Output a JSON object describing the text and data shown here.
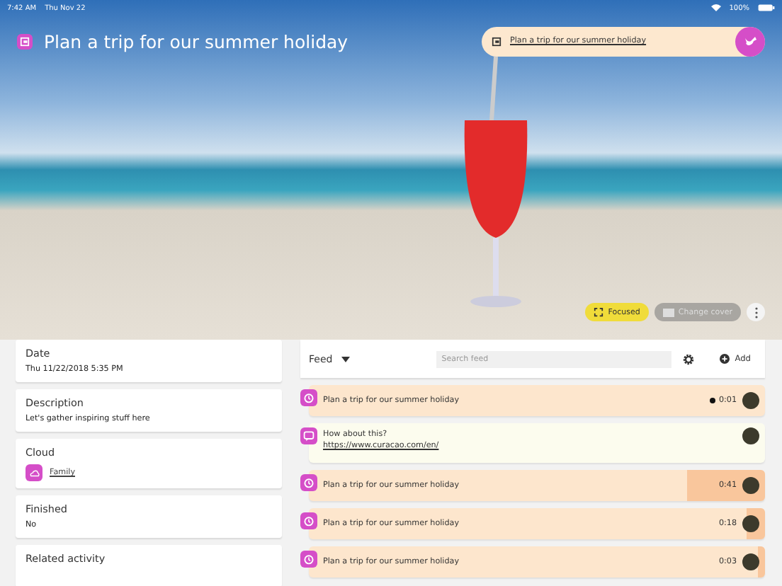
{
  "status_bar": {
    "time": "7:42 AM",
    "date": "Thu Nov 22",
    "battery": "100%"
  },
  "header": {
    "title": "Plan a trip for our summer holiday",
    "pinned_link": "Plan a trip for our summer holiday"
  },
  "cover_actions": {
    "focused": {
      "label": "Focused",
      "on": true
    },
    "change_cover": {
      "label": "Change cover",
      "disabled": true
    }
  },
  "details": [
    {
      "kind": "text",
      "label": "Date",
      "value": "Thu 11/22/2018 5:35 PM"
    },
    {
      "kind": "text",
      "label": "Description",
      "value": "Let's gather inspiring stuff here"
    },
    {
      "kind": "link",
      "label": "Cloud",
      "value": "Family"
    },
    {
      "kind": "text",
      "label": "Finished",
      "value": "No"
    },
    {
      "kind": "heading",
      "label": "Related activity"
    }
  ],
  "feed": {
    "filter": "Feed",
    "search_placeholder": "Search feed",
    "add_label": "Add",
    "items": [
      {
        "kind": "timer",
        "text": "Plan a trip for our summer holiday",
        "duration": "0:01",
        "recording": true,
        "level": 0
      },
      {
        "kind": "note",
        "text": "How about this?",
        "link": "https://www.curacao.com/en/"
      },
      {
        "kind": "timer",
        "text": "Plan a trip for our summer holiday",
        "duration": "0:41",
        "recording": false,
        "level": 0.17
      },
      {
        "kind": "timer",
        "text": "Plan a trip for our summer holiday",
        "duration": "0:18",
        "recording": false,
        "level": 0.04
      },
      {
        "kind": "timer",
        "text": "Plan a trip for our summer holiday",
        "duration": "0:03",
        "recording": false,
        "level": 0.015
      }
    ]
  }
}
